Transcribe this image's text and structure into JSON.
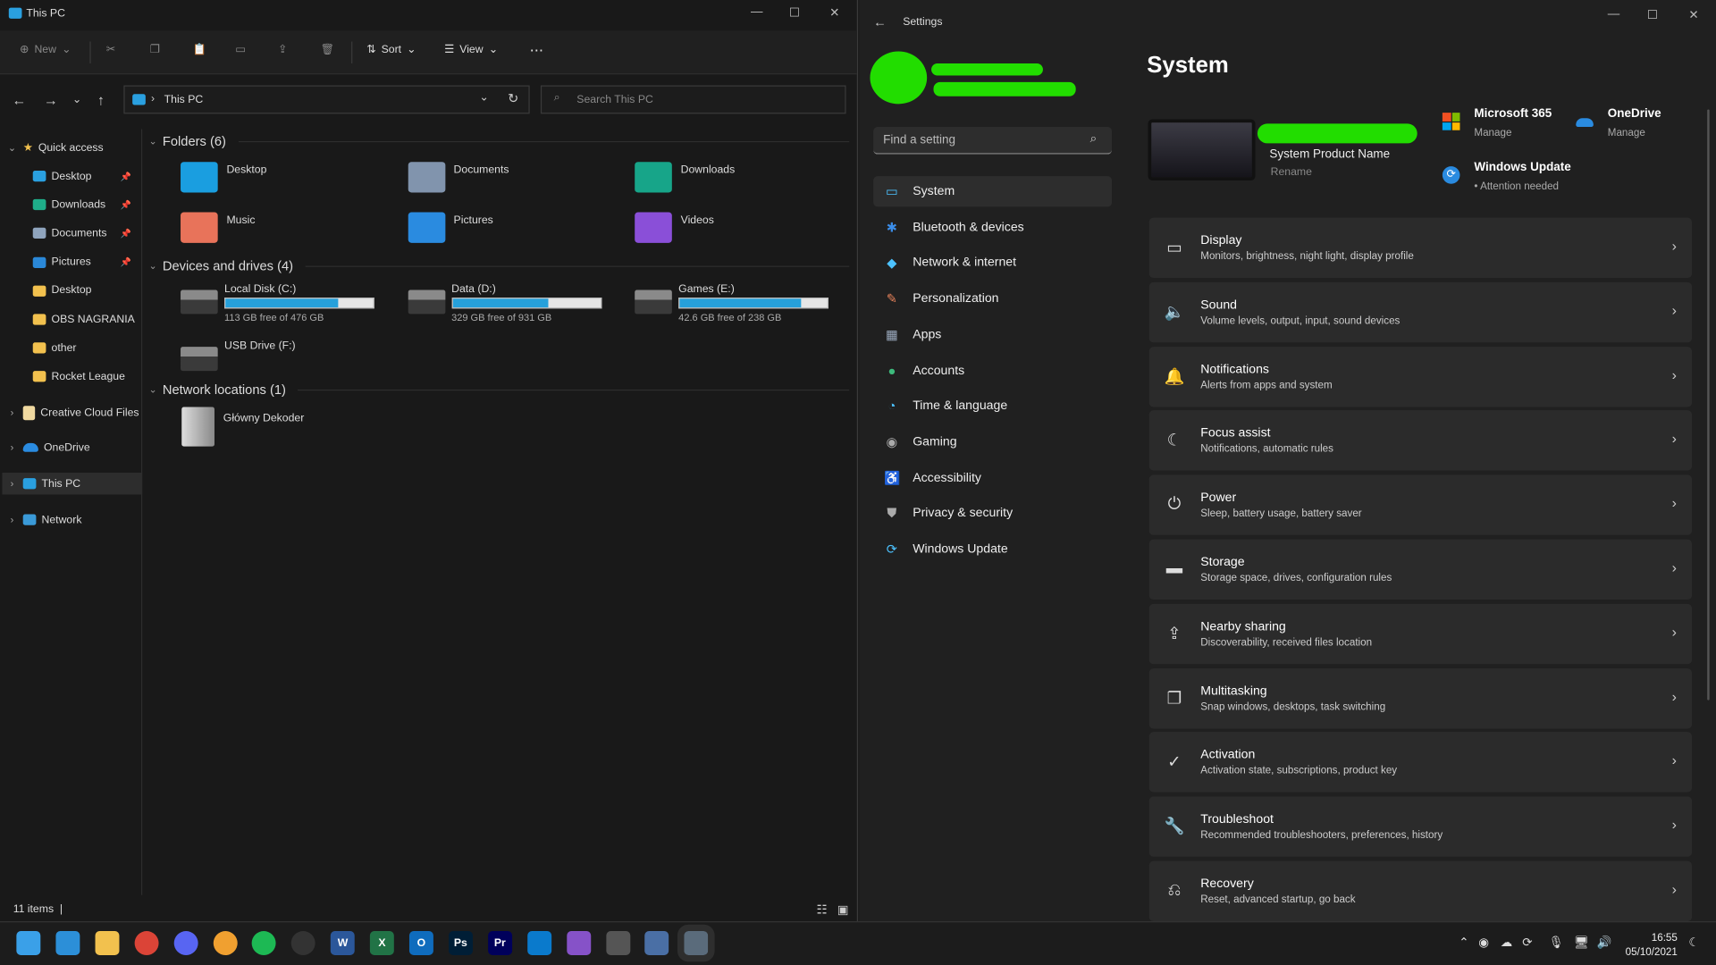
{
  "explorer": {
    "title": "This PC",
    "toolbar": {
      "new": "New",
      "sort": "Sort",
      "view": "View",
      "more": "..."
    },
    "address": "This PC",
    "search_placeholder": "Search This PC",
    "nav": {
      "quick_access": "Quick access",
      "items": [
        {
          "label": "Desktop",
          "pinned": true,
          "color": "#2aa0e0"
        },
        {
          "label": "Downloads",
          "pinned": true,
          "color": "#1fae8a"
        },
        {
          "label": "Documents",
          "pinned": true,
          "color": "#8fa4bd"
        },
        {
          "label": "Pictures",
          "pinned": true,
          "color": "#2a88d8"
        },
        {
          "label": "Desktop",
          "pinned": false,
          "color": "#f2c14e"
        },
        {
          "label": "OBS NAGRANIA",
          "pinned": false,
          "color": "#f2c14e"
        },
        {
          "label": "other",
          "pinned": false,
          "color": "#f2c14e"
        },
        {
          "label": "Rocket League",
          "pinned": false,
          "color": "#f2c14e"
        }
      ],
      "roots": [
        "Creative Cloud Files",
        "OneDrive",
        "This PC",
        "Network"
      ]
    },
    "groups": {
      "folders": "Folders (6)",
      "drives": "Devices and drives (4)",
      "network": "Network locations (1)"
    },
    "folders": [
      {
        "label": "Desktop",
        "color": "#1a9ee0"
      },
      {
        "label": "Documents",
        "color": "#8194ad"
      },
      {
        "label": "Downloads",
        "color": "#17a589"
      },
      {
        "label": "Music",
        "color": "#e8735a"
      },
      {
        "label": "Pictures",
        "color": "#2a8be0"
      },
      {
        "label": "Videos",
        "color": "#8a4fd8"
      }
    ],
    "drives": [
      {
        "label": "Local Disk (C:)",
        "sub": "113 GB free of 476 GB",
        "used": 0.763
      },
      {
        "label": "Data (D:)",
        "sub": "329 GB free of 931 GB",
        "used": 0.647
      },
      {
        "label": "Games (E:)",
        "sub": "42.6 GB free of 238 GB",
        "used": 0.821
      },
      {
        "label": "USB Drive (F:)"
      }
    ],
    "network_location": "Główny Dekoder",
    "status": "11 items"
  },
  "settings": {
    "title": "Settings",
    "search_placeholder": "Find a setting",
    "nav": [
      {
        "label": "System",
        "icon": "▭",
        "color": "#4cc2ff"
      },
      {
        "label": "Bluetooth & devices",
        "icon": "✱",
        "color": "#3b8eea"
      },
      {
        "label": "Network & internet",
        "icon": "◆",
        "color": "#4cc2ff"
      },
      {
        "label": "Personalization",
        "icon": "✎",
        "color": "#e8825a"
      },
      {
        "label": "Apps",
        "icon": "▦",
        "color": "#9aa9bd"
      },
      {
        "label": "Accounts",
        "icon": "●",
        "color": "#3dba7c"
      },
      {
        "label": "Time & language",
        "icon": "◔",
        "color": "#4cc2ff"
      },
      {
        "label": "Gaming",
        "icon": "◉",
        "color": "#aaaaaa"
      },
      {
        "label": "Accessibility",
        "icon": "♿",
        "color": "#4cc2ff"
      },
      {
        "label": "Privacy & security",
        "icon": "⛊",
        "color": "#aaaaaa"
      },
      {
        "label": "Windows Update",
        "icon": "⟳",
        "color": "#4cc2ff"
      }
    ],
    "heading": "System",
    "device": {
      "name": "System Product Name",
      "rename": "Rename"
    },
    "quick": [
      {
        "title": "Microsoft 365",
        "sub": "Manage"
      },
      {
        "title": "OneDrive",
        "sub": "Manage"
      },
      {
        "title": "Windows Update",
        "sub": "Attention needed"
      }
    ],
    "cards": [
      {
        "title": "Display",
        "sub": "Monitors, brightness, night light, display profile",
        "icon": "▭"
      },
      {
        "title": "Sound",
        "sub": "Volume levels, output, input, sound devices",
        "icon": "🔈"
      },
      {
        "title": "Notifications",
        "sub": "Alerts from apps and system",
        "icon": "🔔"
      },
      {
        "title": "Focus assist",
        "sub": "Notifications, automatic rules",
        "icon": "☾"
      },
      {
        "title": "Power",
        "sub": "Sleep, battery usage, battery saver",
        "icon": "⏻"
      },
      {
        "title": "Storage",
        "sub": "Storage space, drives, configuration rules",
        "icon": "▬"
      },
      {
        "title": "Nearby sharing",
        "sub": "Discoverability, received files location",
        "icon": "⇪"
      },
      {
        "title": "Multitasking",
        "sub": "Snap windows, desktops, task switching",
        "icon": "❐"
      },
      {
        "title": "Activation",
        "sub": "Activation state, subscriptions, product key",
        "icon": "✓"
      },
      {
        "title": "Troubleshoot",
        "sub": "Recommended troubleshooters, preferences, history",
        "icon": "🔧"
      },
      {
        "title": "Recovery",
        "sub": "Reset, advanced startup, go back",
        "icon": "⎌"
      }
    ]
  },
  "taskbar": {
    "apps": [
      {
        "name": "start",
        "label": "",
        "bg": "#3aa0e8"
      },
      {
        "name": "desktop",
        "label": "",
        "bg": "#2c8fd8"
      },
      {
        "name": "file-explorer",
        "label": "",
        "bg": "#f2c14e"
      },
      {
        "name": "chrome",
        "label": "",
        "bg": "#db4437"
      },
      {
        "name": "discord",
        "label": "",
        "bg": "#5865f2"
      },
      {
        "name": "discord-canary",
        "label": "",
        "bg": "#f0a030"
      },
      {
        "name": "spotify",
        "label": "",
        "bg": "#1db954"
      },
      {
        "name": "obs",
        "label": "",
        "bg": "#333333"
      },
      {
        "name": "word",
        "label": "W",
        "bg": "#2b579a"
      },
      {
        "name": "excel",
        "label": "X",
        "bg": "#217346"
      },
      {
        "name": "outlook",
        "label": "O",
        "bg": "#0f6cbd"
      },
      {
        "name": "photoshop",
        "label": "Ps",
        "bg": "#001e36"
      },
      {
        "name": "premiere",
        "label": "Pr",
        "bg": "#00005b"
      },
      {
        "name": "vscode",
        "label": "",
        "bg": "#0a7acc"
      },
      {
        "name": "visual-studio",
        "label": "",
        "bg": "#8652c8"
      },
      {
        "name": "vpn",
        "label": "",
        "bg": "#555555"
      },
      {
        "name": "remote-desktop",
        "label": "",
        "bg": "#4a6fa5"
      },
      {
        "name": "settings",
        "label": "",
        "bg": "#5a6b7b"
      }
    ],
    "time": "16:55",
    "date": "05/10/2021"
  }
}
